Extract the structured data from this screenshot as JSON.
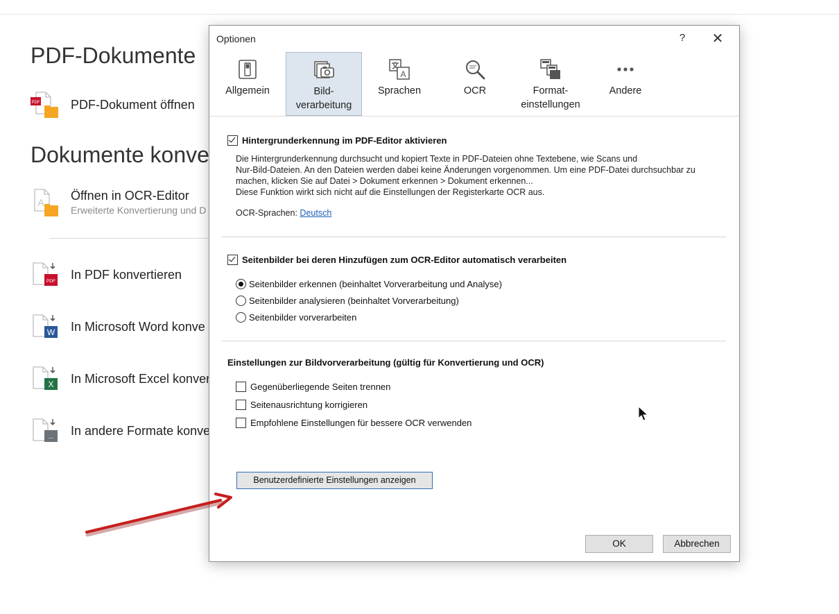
{
  "background": {
    "heading_pdf": "PDF-Dokumente",
    "item_open_pdf": "PDF-Dokument öffnen",
    "heading_convert": "Dokumente konve",
    "item_ocr_editor": "Öffnen in OCR-Editor",
    "item_ocr_editor_sub": "Erweiterte Konvertierung und D",
    "item_to_pdf": "In PDF konvertieren",
    "item_to_word": "In Microsoft Word konve",
    "item_to_excel": "In Microsoft Excel konvert",
    "item_to_other": "In andere Formate konve",
    "pdf_badge": "PDF",
    "word_badge": "W",
    "excel_badge": "X",
    "other_badge": "..."
  },
  "dialog": {
    "title": "Optionen",
    "help": "?",
    "close": "✕",
    "tabs": [
      {
        "line1": "Allgemein",
        "line2": ""
      },
      {
        "line1": "Bild-",
        "line2": "verarbeitung"
      },
      {
        "line1": "Sprachen",
        "line2": ""
      },
      {
        "line1": "OCR",
        "line2": ""
      },
      {
        "line1": "Format-",
        "line2": "einstellungen"
      },
      {
        "line1": "Andere",
        "line2": ""
      }
    ],
    "active_tab": "Bild-verarbeitung",
    "section1": {
      "checkbox_label": "Hintergrunderkennung im PDF-Editor aktivieren",
      "checked": true,
      "desc_line1": "Die Hintergrunderkennung durchsucht und kopiert Texte in PDF-Dateien ohne Textebene, wie Scans und",
      "desc_line2": "Nur-Bild-Dateien. An den Dateien werden dabei keine Änderungen vorgenommen. Um eine PDF-Datei durchsuchbar zu",
      "desc_line3": "machen, klicken Sie auf Datei > Dokument erkennen > Dokument erkennen...",
      "desc_line4": "Diese Funktion wirkt sich nicht auf die Einstellungen der Registerkarte OCR aus.",
      "ocr_lang_label": "OCR-Sprachen:",
      "ocr_lang_link": "Deutsch"
    },
    "section2": {
      "checkbox_label": "Seitenbilder bei deren Hinzufügen zum OCR-Editor automatisch verarbeiten",
      "checked": true,
      "radio1": "Seitenbilder erkennen (beinhaltet Vorverarbeitung und Analyse)",
      "radio2": "Seitenbilder analysieren (beinhaltet Vorverarbeitung)",
      "radio3": "Seitenbilder vorverarbeiten",
      "selected": "Seitenbilder erkennen (beinhaltet Vorverarbeitung und Analyse)"
    },
    "section3": {
      "title": "Einstellungen zur Bildvorverarbeitung (gültig für Konvertierung und OCR)",
      "opt1": "Gegenüberliegende Seiten trennen",
      "opt2": "Seitenausrichtung korrigieren",
      "opt3": "Empfohlene Einstellungen für bessere OCR verwenden"
    },
    "custom_button": "Benutzerdefinierte Einstellungen anzeigen",
    "ok": "OK",
    "cancel": "Abbrechen"
  },
  "colors": {
    "accent_blue": "#2f6fb5",
    "link_blue": "#1a5fb4",
    "arrow_red": "#c81e1e",
    "pdf_red": "#c8102e",
    "word_blue": "#2b579a",
    "excel_green": "#217346",
    "folder_orange": "#f5a623"
  }
}
